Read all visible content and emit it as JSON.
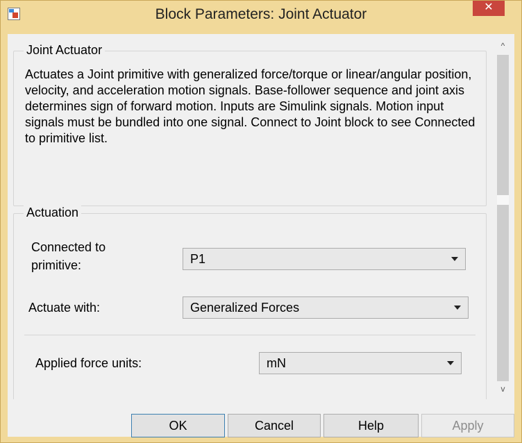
{
  "window": {
    "title": "Block Parameters: Joint Actuator",
    "close_symbol": "✕"
  },
  "block": {
    "group_title": "Joint Actuator",
    "description": "Actuates a Joint primitive with generalized force/torque or linear/angular position, velocity, and acceleration motion signals. Base-follower sequence and joint axis determines sign of forward motion. Inputs are Simulink signals. Motion input signals must be bundled into one signal. Connect to Joint block to see Connected to primitive list."
  },
  "actuation": {
    "group_title": "Actuation",
    "connected_label_line1": "Connected to",
    "connected_label_line2": "primitive:",
    "connected_value": "P1",
    "actuate_label": "Actuate with:",
    "actuate_value": "Generalized Forces",
    "force_units_label": "Applied force units:",
    "force_units_value": "mN"
  },
  "buttons": {
    "ok": "OK",
    "cancel": "Cancel",
    "help": "Help",
    "apply": "Apply"
  },
  "icons": {
    "app": "simulink-block-icon",
    "scroll_up": "^",
    "scroll_down": "v"
  }
}
